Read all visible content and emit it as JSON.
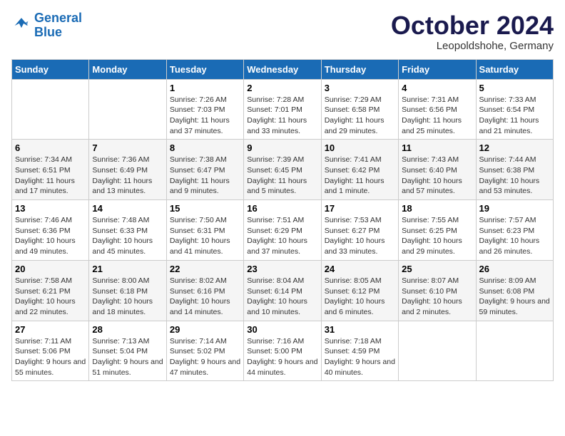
{
  "header": {
    "logo_line1": "General",
    "logo_line2": "Blue",
    "month": "October 2024",
    "location": "Leopoldshohe, Germany"
  },
  "weekdays": [
    "Sunday",
    "Monday",
    "Tuesday",
    "Wednesday",
    "Thursday",
    "Friday",
    "Saturday"
  ],
  "weeks": [
    [
      {
        "day": "",
        "sunrise": "",
        "sunset": "",
        "daylight": ""
      },
      {
        "day": "",
        "sunrise": "",
        "sunset": "",
        "daylight": ""
      },
      {
        "day": "1",
        "sunrise": "Sunrise: 7:26 AM",
        "sunset": "Sunset: 7:03 PM",
        "daylight": "Daylight: 11 hours and 37 minutes."
      },
      {
        "day": "2",
        "sunrise": "Sunrise: 7:28 AM",
        "sunset": "Sunset: 7:01 PM",
        "daylight": "Daylight: 11 hours and 33 minutes."
      },
      {
        "day": "3",
        "sunrise": "Sunrise: 7:29 AM",
        "sunset": "Sunset: 6:58 PM",
        "daylight": "Daylight: 11 hours and 29 minutes."
      },
      {
        "day": "4",
        "sunrise": "Sunrise: 7:31 AM",
        "sunset": "Sunset: 6:56 PM",
        "daylight": "Daylight: 11 hours and 25 minutes."
      },
      {
        "day": "5",
        "sunrise": "Sunrise: 7:33 AM",
        "sunset": "Sunset: 6:54 PM",
        "daylight": "Daylight: 11 hours and 21 minutes."
      }
    ],
    [
      {
        "day": "6",
        "sunrise": "Sunrise: 7:34 AM",
        "sunset": "Sunset: 6:51 PM",
        "daylight": "Daylight: 11 hours and 17 minutes."
      },
      {
        "day": "7",
        "sunrise": "Sunrise: 7:36 AM",
        "sunset": "Sunset: 6:49 PM",
        "daylight": "Daylight: 11 hours and 13 minutes."
      },
      {
        "day": "8",
        "sunrise": "Sunrise: 7:38 AM",
        "sunset": "Sunset: 6:47 PM",
        "daylight": "Daylight: 11 hours and 9 minutes."
      },
      {
        "day": "9",
        "sunrise": "Sunrise: 7:39 AM",
        "sunset": "Sunset: 6:45 PM",
        "daylight": "Daylight: 11 hours and 5 minutes."
      },
      {
        "day": "10",
        "sunrise": "Sunrise: 7:41 AM",
        "sunset": "Sunset: 6:42 PM",
        "daylight": "Daylight: 11 hours and 1 minute."
      },
      {
        "day": "11",
        "sunrise": "Sunrise: 7:43 AM",
        "sunset": "Sunset: 6:40 PM",
        "daylight": "Daylight: 10 hours and 57 minutes."
      },
      {
        "day": "12",
        "sunrise": "Sunrise: 7:44 AM",
        "sunset": "Sunset: 6:38 PM",
        "daylight": "Daylight: 10 hours and 53 minutes."
      }
    ],
    [
      {
        "day": "13",
        "sunrise": "Sunrise: 7:46 AM",
        "sunset": "Sunset: 6:36 PM",
        "daylight": "Daylight: 10 hours and 49 minutes."
      },
      {
        "day": "14",
        "sunrise": "Sunrise: 7:48 AM",
        "sunset": "Sunset: 6:33 PM",
        "daylight": "Daylight: 10 hours and 45 minutes."
      },
      {
        "day": "15",
        "sunrise": "Sunrise: 7:50 AM",
        "sunset": "Sunset: 6:31 PM",
        "daylight": "Daylight: 10 hours and 41 minutes."
      },
      {
        "day": "16",
        "sunrise": "Sunrise: 7:51 AM",
        "sunset": "Sunset: 6:29 PM",
        "daylight": "Daylight: 10 hours and 37 minutes."
      },
      {
        "day": "17",
        "sunrise": "Sunrise: 7:53 AM",
        "sunset": "Sunset: 6:27 PM",
        "daylight": "Daylight: 10 hours and 33 minutes."
      },
      {
        "day": "18",
        "sunrise": "Sunrise: 7:55 AM",
        "sunset": "Sunset: 6:25 PM",
        "daylight": "Daylight: 10 hours and 29 minutes."
      },
      {
        "day": "19",
        "sunrise": "Sunrise: 7:57 AM",
        "sunset": "Sunset: 6:23 PM",
        "daylight": "Daylight: 10 hours and 26 minutes."
      }
    ],
    [
      {
        "day": "20",
        "sunrise": "Sunrise: 7:58 AM",
        "sunset": "Sunset: 6:21 PM",
        "daylight": "Daylight: 10 hours and 22 minutes."
      },
      {
        "day": "21",
        "sunrise": "Sunrise: 8:00 AM",
        "sunset": "Sunset: 6:18 PM",
        "daylight": "Daylight: 10 hours and 18 minutes."
      },
      {
        "day": "22",
        "sunrise": "Sunrise: 8:02 AM",
        "sunset": "Sunset: 6:16 PM",
        "daylight": "Daylight: 10 hours and 14 minutes."
      },
      {
        "day": "23",
        "sunrise": "Sunrise: 8:04 AM",
        "sunset": "Sunset: 6:14 PM",
        "daylight": "Daylight: 10 hours and 10 minutes."
      },
      {
        "day": "24",
        "sunrise": "Sunrise: 8:05 AM",
        "sunset": "Sunset: 6:12 PM",
        "daylight": "Daylight: 10 hours and 6 minutes."
      },
      {
        "day": "25",
        "sunrise": "Sunrise: 8:07 AM",
        "sunset": "Sunset: 6:10 PM",
        "daylight": "Daylight: 10 hours and 2 minutes."
      },
      {
        "day": "26",
        "sunrise": "Sunrise: 8:09 AM",
        "sunset": "Sunset: 6:08 PM",
        "daylight": "Daylight: 9 hours and 59 minutes."
      }
    ],
    [
      {
        "day": "27",
        "sunrise": "Sunrise: 7:11 AM",
        "sunset": "Sunset: 5:06 PM",
        "daylight": "Daylight: 9 hours and 55 minutes."
      },
      {
        "day": "28",
        "sunrise": "Sunrise: 7:13 AM",
        "sunset": "Sunset: 5:04 PM",
        "daylight": "Daylight: 9 hours and 51 minutes."
      },
      {
        "day": "29",
        "sunrise": "Sunrise: 7:14 AM",
        "sunset": "Sunset: 5:02 PM",
        "daylight": "Daylight: 9 hours and 47 minutes."
      },
      {
        "day": "30",
        "sunrise": "Sunrise: 7:16 AM",
        "sunset": "Sunset: 5:00 PM",
        "daylight": "Daylight: 9 hours and 44 minutes."
      },
      {
        "day": "31",
        "sunrise": "Sunrise: 7:18 AM",
        "sunset": "Sunset: 4:59 PM",
        "daylight": "Daylight: 9 hours and 40 minutes."
      },
      {
        "day": "",
        "sunrise": "",
        "sunset": "",
        "daylight": ""
      },
      {
        "day": "",
        "sunrise": "",
        "sunset": "",
        "daylight": ""
      }
    ]
  ]
}
